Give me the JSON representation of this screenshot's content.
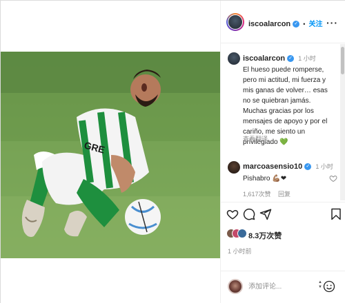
{
  "post": {
    "author": {
      "username": "iscoalarcon",
      "follow_label": "关注",
      "separator": "•"
    },
    "caption": {
      "username": "iscoalarcon",
      "time": "1 小时",
      "text_main": "El hueso puede romperse, pero mi actitud, mi fuerza y mis ganas de volver… esas no se quiebran jamás. Muchas gracias por los mensajes de apoyo y por el cariño, me siento un privilegiado",
      "heart_emoji": "💚",
      "translate_label": "查看翻译"
    },
    "comment": {
      "username": "marcoasensio10",
      "time": "1 小时",
      "text": "Pishabro",
      "emojis": "💪🏽❤",
      "likes": "1,617次赞",
      "reply_label": "回复"
    },
    "like_count": "8.3万次赞",
    "post_time": "1 小时前",
    "comment_box": {
      "placeholder": "添加评论..."
    }
  },
  "icons": {
    "more": "more-horizontal-icon",
    "like": "heart-icon",
    "comment": "comment-icon",
    "share": "send-icon",
    "save": "bookmark-icon",
    "verified": "verified-badge-icon",
    "emoji": "emoji-icon"
  },
  "colors": {
    "link_blue": "#0095f6",
    "verified_blue": "#3897f0",
    "text": "#262626",
    "muted": "#8e8e8e",
    "pitch_green": "#6f9a4f"
  }
}
